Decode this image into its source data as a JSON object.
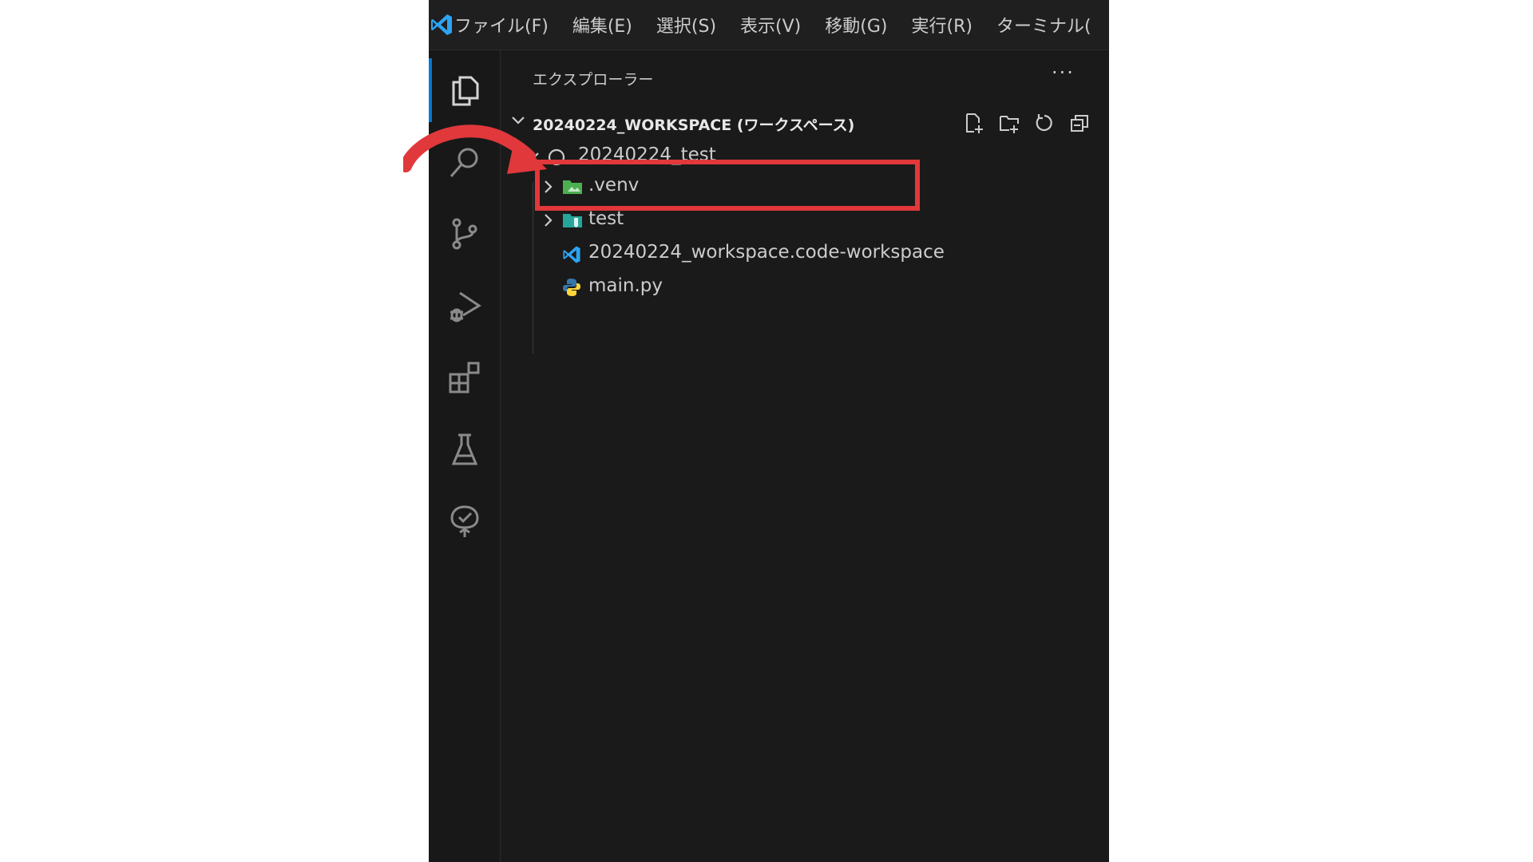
{
  "menubar": {
    "items": [
      "ファイル(F)",
      "編集(E)",
      "選択(S)",
      "表示(V)",
      "移動(G)",
      "実行(R)",
      "ターミナル("
    ]
  },
  "activity_bar": {
    "icons": [
      "files-icon",
      "search-icon",
      "source-control-icon",
      "run-debug-icon",
      "extensions-icon",
      "testing-icon",
      "tree-check-icon"
    ]
  },
  "sidebar": {
    "title": "エクスプローラー",
    "more": "···",
    "workspace": {
      "label": "20240224_WORKSPACE (ワークスペース)"
    },
    "tree": {
      "root_folder": "20240224_test",
      "items": [
        ".venv",
        "test",
        "20240224_workspace.code-workspace",
        "main.py"
      ]
    }
  },
  "annotation": {
    "highlight_color": "#e0383b"
  },
  "colors": {
    "accent": "#0078d4",
    "background": "#1e1e1e"
  }
}
